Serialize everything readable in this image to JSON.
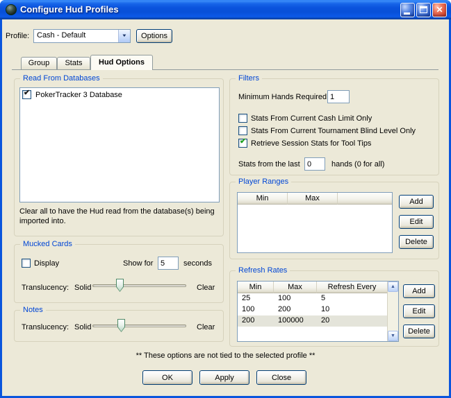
{
  "window": {
    "title": "Configure Hud Profiles"
  },
  "profile": {
    "label": "Profile:",
    "value": "Cash - Default",
    "options_button": "Options"
  },
  "tabs": [
    {
      "label": "Group"
    },
    {
      "label": "Stats"
    },
    {
      "label": "Hud Options"
    }
  ],
  "read_from_databases": {
    "title": "Read From Databases",
    "items": [
      {
        "label": "PokerTracker 3 Database",
        "checked": true
      }
    ],
    "note": "Clear all to have the Hud read from the database(s) being imported into."
  },
  "mucked_cards": {
    "title": "Mucked Cards",
    "display_label": "Display",
    "display_checked": false,
    "show_for_label": "Show for",
    "show_for_value": "5",
    "seconds_label": "seconds",
    "translucency_label": "Translucency:",
    "solid_label": "Solid",
    "clear_label": "Clear"
  },
  "notes": {
    "title": "Notes",
    "translucency_label": "Translucency:",
    "solid_label": "Solid",
    "clear_label": "Clear"
  },
  "filters": {
    "title": "Filters",
    "minimum_hands_label": "Minimum Hands Required:",
    "minimum_hands_value": "1",
    "checkboxes": [
      {
        "label": "Stats From Current Cash Limit Only",
        "checked": false
      },
      {
        "label": "Stats From Current Tournament Blind Level Only",
        "checked": false
      },
      {
        "label": "Retrieve Session Stats for Tool Tips",
        "checked": true
      }
    ],
    "stats_last_label": "Stats from the last",
    "stats_last_value": "0",
    "stats_last_suffix": "hands (0 for all)"
  },
  "player_ranges": {
    "title": "Player Ranges",
    "columns": [
      "Min",
      "Max"
    ],
    "rows": [],
    "buttons": [
      "Add",
      "Edit",
      "Delete"
    ]
  },
  "refresh_rates": {
    "title": "Refresh Rates",
    "columns": [
      "Min",
      "Max",
      "Refresh Every"
    ],
    "rows": [
      [
        "25",
        "100",
        "5"
      ],
      [
        "100",
        "200",
        "10"
      ],
      [
        "200",
        "100000",
        "20"
      ]
    ],
    "buttons": [
      "Add",
      "Edit",
      "Delete"
    ]
  },
  "footer": {
    "note": "** These options are not tied to the selected profile **",
    "buttons": [
      "OK",
      "Apply",
      "Close"
    ]
  },
  "icons": {
    "close": "✕",
    "dropdown_arrow": "▼",
    "scroll_up": "▲",
    "scroll_down": "▼",
    "check": "✔"
  },
  "colors": {
    "titlebar_blue": "#0854d8",
    "dialog_bg": "#ece9d8",
    "group_title_blue": "#0046d5",
    "check_green": "#1ea11e",
    "field_border": "#7f9db9"
  }
}
